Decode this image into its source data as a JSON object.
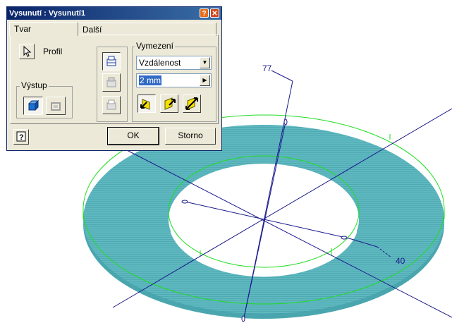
{
  "dialog": {
    "title": "Vysunutí : Vysunutí1",
    "tabs": [
      {
        "label": "Tvar",
        "active": true
      },
      {
        "label": "Další",
        "active": false
      }
    ],
    "profile_label": "Profil",
    "output_group_label": "Výstup",
    "extents_group_label": "Vymezení",
    "extents_type": "Vzdálenost",
    "distance_value": "2 mm",
    "ok_label": "OK",
    "cancel_label": "Storno"
  },
  "viewport": {
    "dimension_outer": "77",
    "dimension_inner": "40",
    "colors": {
      "face_fill": "#5fb8c0",
      "hatch": "#3a9aa3",
      "edge_green": "#22dd22",
      "axis_blue": "#1a1a8c"
    }
  }
}
